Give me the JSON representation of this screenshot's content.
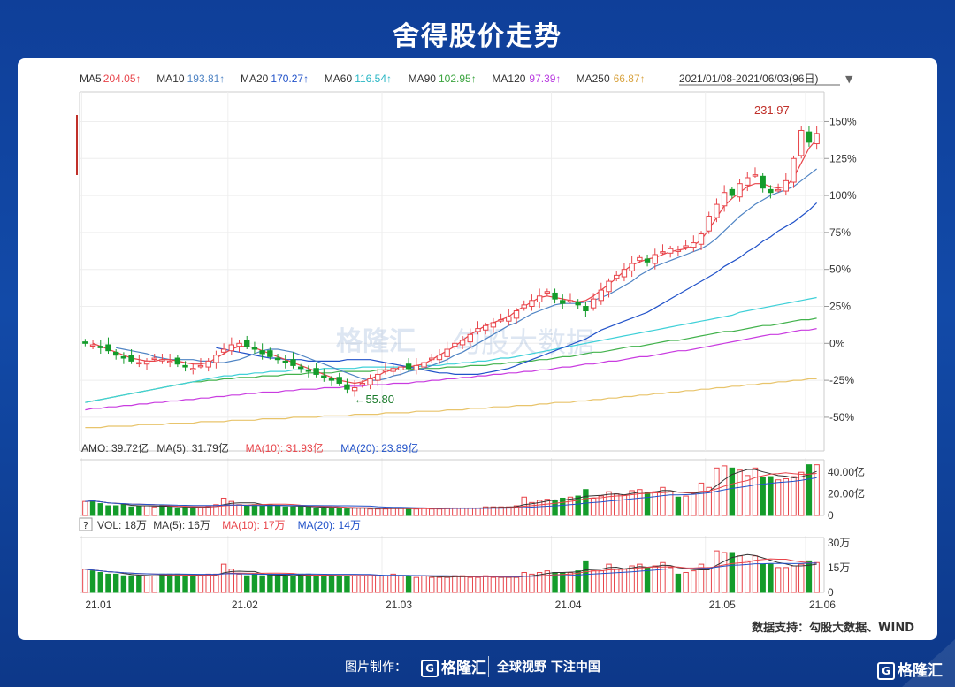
{
  "title": "舍得股价走势",
  "source_note": "数据支持：勾股大数据、WIND",
  "footer": {
    "credit": "图片制作：",
    "logo": "格隆汇",
    "slogan": "全球视野 下注中国"
  },
  "watermark": {
    "logo": "格隆汇",
    "text": "勾股大数据"
  },
  "colors": {
    "up": "#e8444a",
    "down": "#149c2b",
    "background": "#1247a8",
    "ma5": "#e8444a",
    "ma10": "#4f84c4",
    "ma20": "#2152c9",
    "ma60": "#3fd0d8",
    "ma90": "#42b24c",
    "ma120": "#c93ce0",
    "ma250": "#e8c46b"
  },
  "chart_data": {
    "type": "candlestick",
    "legend": [
      {
        "label": "MA5",
        "value": "204.05↑",
        "color": "#e8444a"
      },
      {
        "label": "MA10",
        "value": "193.81↑",
        "color": "#4f84c4"
      },
      {
        "label": "MA20",
        "value": "170.27↑",
        "color": "#2152c9"
      },
      {
        "label": "MA60",
        "value": "116.54↑",
        "color": "#29b6c4"
      },
      {
        "label": "MA90",
        "value": "102.95↑",
        "color": "#3ba43f"
      },
      {
        "label": "MA120",
        "value": "97.39↑",
        "color": "#b93ce0"
      },
      {
        "label": "MA250",
        "value": "66.87↑",
        "color": "#d9a441"
      }
    ],
    "date_range": "2021/01/08-2021/06/03(96日)",
    "annotations": {
      "high": "231.97",
      "low": "55.80"
    },
    "y_axis": {
      "ticks": [
        "150%",
        "125%",
        "100%",
        "75%",
        "50%",
        "25%",
        "0%",
        "-25%",
        "-50%"
      ],
      "range_pct": [
        -62,
        170
      ]
    },
    "x_axis": {
      "ticks": [
        "21.01",
        "21.02",
        "21.03",
        "21.04",
        "21.05",
        "21.06"
      ]
    },
    "close_pct": [
      0,
      -1,
      -3,
      -5,
      -8,
      -10,
      -12,
      -13,
      -12,
      -10,
      -11,
      -12,
      -14,
      -16,
      -17,
      -15,
      -12,
      -8,
      -4,
      -1,
      0,
      -2,
      -4,
      -7,
      -9,
      -11,
      -13,
      -15,
      -17,
      -19,
      -21,
      -23,
      -25,
      -27,
      -31,
      -30,
      -27,
      -24,
      -21,
      -18,
      -17,
      -16,
      -17,
      -15,
      -13,
      -10,
      -8,
      -4,
      0,
      2,
      6,
      10,
      12,
      14,
      16,
      18,
      22,
      26,
      29,
      32,
      35,
      30,
      27,
      29,
      26,
      22,
      30,
      36,
      42,
      46,
      50,
      54,
      58,
      55,
      60,
      62,
      64,
      63,
      66,
      68,
      74,
      86,
      94,
      102,
      100,
      108,
      112,
      114,
      105,
      102,
      104,
      110,
      125,
      144,
      136,
      142
    ],
    "moving_averages_pct": {
      "ma5": [
        0,
        -2,
        -4,
        -6,
        -8,
        -10,
        -11,
        -12,
        -12,
        -11,
        -11,
        -12,
        -13,
        -14,
        -14,
        -13,
        -10,
        -7,
        -4,
        -2,
        -2,
        -3,
        -5,
        -7,
        -9,
        -11,
        -13,
        -15,
        -17,
        -19,
        -21,
        -23,
        -25,
        -26,
        -27,
        -26,
        -24,
        -22,
        -19,
        -18,
        -16,
        -16,
        -15,
        -14,
        -11,
        -8,
        -5,
        -2,
        2,
        6,
        9,
        12,
        14,
        16,
        18,
        22,
        25,
        28,
        31,
        32,
        31,
        30,
        29,
        28,
        29,
        32,
        36,
        40,
        44,
        49,
        53,
        55,
        57,
        58,
        60,
        62,
        63,
        64,
        66,
        70,
        77,
        85,
        93,
        98,
        102,
        106,
        108,
        108,
        106,
        105,
        106,
        112,
        122,
        132,
        138
      ],
      "ma10": [
        -3,
        -4,
        -5,
        -6,
        -7,
        -9,
        -10,
        -11,
        -11,
        -11,
        -11,
        -12,
        -12,
        -13,
        -13,
        -12,
        -11,
        -9,
        -7,
        -5,
        -4,
        -4,
        -5,
        -6,
        -8,
        -10,
        -12,
        -14,
        -16,
        -18,
        -20,
        -22,
        -24,
        -25,
        -25,
        -24,
        -22,
        -21,
        -19,
        -18,
        -17,
        -15,
        -13,
        -11,
        -8,
        -6,
        -3,
        0,
        3,
        6,
        9,
        12,
        14,
        17,
        20,
        22,
        24,
        26,
        27,
        27,
        27,
        28,
        29,
        31,
        33,
        36,
        39,
        42,
        46,
        49,
        52,
        54,
        56,
        58,
        60,
        62,
        64,
        67,
        71,
        76,
        81,
        86,
        90,
        94,
        97,
        100,
        102,
        104,
        106,
        110,
        114,
        118
      ],
      "ma20": [
        -3,
        -4,
        -5,
        -6,
        -7,
        -8,
        -9,
        -10,
        -10,
        -11,
        -11,
        -11,
        -12,
        -12,
        -12,
        -12,
        -12,
        -11,
        -11,
        -11,
        -11,
        -12,
        -13,
        -14,
        -15,
        -16,
        -17,
        -18,
        -19,
        -20,
        -20,
        -21,
        -21,
        -21,
        -21,
        -20,
        -19,
        -18,
        -17,
        -15,
        -13,
        -11,
        -9,
        -7,
        -5,
        -3,
        -1,
        1,
        3,
        6,
        9,
        11,
        13,
        15,
        17,
        19,
        21,
        24,
        27,
        30,
        33,
        36,
        39,
        42,
        45,
        48,
        52,
        55,
        58,
        62,
        65,
        69,
        72,
        76,
        79,
        82,
        86,
        90,
        95
      ],
      "ma60": [
        -40,
        -39,
        -38,
        -37,
        -36,
        -35,
        -34,
        -33,
        -32,
        -31,
        -30,
        -29,
        -28,
        -27,
        -26,
        -25,
        -24,
        -23,
        -22,
        -22,
        -21,
        -21,
        -20,
        -20,
        -19,
        -19,
        -19,
        -18,
        -18,
        -18,
        -18,
        -17,
        -17,
        -17,
        -17,
        -17,
        -16,
        -16,
        -16,
        -16,
        -16,
        -16,
        -16,
        -16,
        -15,
        -15,
        -15,
        -14,
        -14,
        -13,
        -13,
        -12,
        -12,
        -11,
        -10,
        -10,
        -9,
        -8,
        -7,
        -6,
        -5,
        -4,
        -3,
        -2,
        -1,
        0,
        1,
        2,
        3,
        4,
        5,
        6,
        7,
        8,
        9,
        10,
        11,
        12,
        13,
        14,
        15,
        16,
        17,
        18,
        19,
        21,
        22,
        23,
        24,
        25,
        26,
        27,
        28,
        29,
        30,
        31
      ],
      "ma90": [
        -40,
        -39,
        -38,
        -37,
        -36,
        -35,
        -34,
        -33,
        -32,
        -31,
        -30,
        -29,
        -28,
        -27,
        -26,
        -26,
        -25,
        -25,
        -24,
        -24,
        -23,
        -23,
        -23,
        -22,
        -22,
        -22,
        -21,
        -21,
        -21,
        -20,
        -20,
        -20,
        -20,
        -19,
        -19,
        -19,
        -19,
        -19,
        -18,
        -18,
        -18,
        -18,
        -18,
        -17,
        -17,
        -17,
        -17,
        -16,
        -16,
        -16,
        -15,
        -15,
        -15,
        -14,
        -14,
        -13,
        -13,
        -12,
        -12,
        -11,
        -11,
        -10,
        -9,
        -9,
        -8,
        -7,
        -6,
        -6,
        -5,
        -4,
        -3,
        -2,
        -2,
        -1,
        0,
        1,
        2,
        2,
        3,
        4,
        5,
        6,
        7,
        8,
        8,
        9,
        10,
        11,
        12,
        12,
        13,
        14,
        15,
        16,
        16,
        17
      ],
      "ma120": [
        -45,
        -44,
        -44,
        -43,
        -43,
        -42,
        -42,
        -41,
        -41,
        -40,
        -40,
        -39,
        -39,
        -38,
        -38,
        -37,
        -37,
        -36,
        -36,
        -35,
        -35,
        -34,
        -34,
        -33,
        -33,
        -33,
        -32,
        -32,
        -31,
        -31,
        -31,
        -30,
        -30,
        -30,
        -29,
        -29,
        -29,
        -28,
        -28,
        -28,
        -27,
        -27,
        -27,
        -26,
        -26,
        -25,
        -25,
        -24,
        -24,
        -23,
        -23,
        -22,
        -22,
        -21,
        -21,
        -20,
        -20,
        -19,
        -19,
        -18,
        -18,
        -17,
        -16,
        -16,
        -15,
        -14,
        -14,
        -13,
        -12,
        -12,
        -11,
        -10,
        -9,
        -9,
        -8,
        -7,
        -6,
        -5,
        -5,
        -4,
        -3,
        -2,
        -1,
        0,
        1,
        2,
        3,
        4,
        5,
        6,
        6,
        7,
        8,
        9,
        9,
        10
      ],
      "ma250": [
        -57,
        -57,
        -57,
        -56,
        -56,
        -56,
        -56,
        -55,
        -55,
        -55,
        -55,
        -54,
        -54,
        -54,
        -54,
        -53,
        -53,
        -53,
        -53,
        -52,
        -52,
        -52,
        -52,
        -51,
        -51,
        -51,
        -51,
        -50,
        -50,
        -50,
        -50,
        -49,
        -49,
        -49,
        -49,
        -48,
        -48,
        -48,
        -48,
        -47,
        -47,
        -47,
        -47,
        -46,
        -46,
        -46,
        -46,
        -45,
        -45,
        -45,
        -44,
        -44,
        -44,
        -43,
        -43,
        -43,
        -42,
        -42,
        -42,
        -41,
        -41,
        -40,
        -40,
        -40,
        -39,
        -39,
        -38,
        -38,
        -37,
        -37,
        -36,
        -36,
        -35,
        -35,
        -34,
        -34,
        -33,
        -33,
        -32,
        -32,
        -31,
        -31,
        -30,
        -30,
        -29,
        -29,
        -28,
        -28,
        -27,
        -27,
        -26,
        -26,
        -25,
        -25,
        -24,
        -24
      ]
    },
    "amount_panel": {
      "legend": [
        {
          "label": "AMO:",
          "value": "39.72亿",
          "color": "#333333"
        },
        {
          "label": "MA(5):",
          "value": "31.79亿",
          "color": "#333333"
        },
        {
          "label": "MA(10):",
          "value": "31.93亿",
          "color": "#e8444a"
        },
        {
          "label": "MA(20):",
          "value": "23.89亿",
          "color": "#2152c9"
        }
      ],
      "y_ticks": [
        "40.00亿",
        "20.00亿",
        "0"
      ],
      "y_max": 50
    },
    "volume_panel": {
      "help": "?",
      "legend": [
        {
          "label": "VOL:",
          "value": "18万",
          "color": "#333333"
        },
        {
          "label": "MA(5):",
          "value": "16万",
          "color": "#333333"
        },
        {
          "label": "MA(10):",
          "value": "17万",
          "color": "#e8444a"
        },
        {
          "label": "MA(20):",
          "value": "14万",
          "color": "#2152c9"
        }
      ],
      "y_ticks": [
        "30万",
        "15万",
        "0"
      ],
      "y_max": 32
    },
    "amount_yi": [
      13,
      14,
      11,
      9,
      9,
      10,
      8,
      9,
      9,
      8,
      9,
      8,
      7,
      8,
      7,
      8,
      9,
      10,
      16,
      13,
      10,
      9,
      10,
      9,
      10,
      9,
      8,
      8,
      9,
      8,
      7,
      7,
      7,
      7,
      6,
      7,
      7,
      6,
      6,
      6,
      7,
      7,
      6,
      6,
      7,
      6,
      6,
      7,
      7,
      7,
      7,
      7,
      8,
      8,
      8,
      8,
      9,
      17,
      12,
      14,
      15,
      14,
      16,
      17,
      18,
      24,
      16,
      18,
      22,
      20,
      19,
      23,
      24,
      21,
      22,
      26,
      22,
      17,
      18,
      20,
      30,
      26,
      44,
      46,
      44,
      42,
      37,
      44,
      35,
      36,
      33,
      34,
      36,
      40,
      47,
      47
    ],
    "volume_wan": [
      14,
      13,
      12,
      11,
      11,
      10,
      10,
      10,
      10,
      10,
      11,
      11,
      11,
      10,
      10,
      10,
      11,
      11,
      17,
      14,
      11,
      10,
      11,
      10,
      11,
      10,
      10,
      10,
      11,
      11,
      10,
      10,
      10,
      10,
      10,
      10,
      10,
      10,
      10,
      10,
      11,
      10,
      10,
      9,
      10,
      9,
      9,
      9,
      10,
      10,
      9,
      9,
      10,
      9,
      9,
      9,
      9,
      12,
      11,
      12,
      13,
      12,
      12,
      12,
      13,
      19,
      13,
      13,
      17,
      14,
      14,
      16,
      17,
      15,
      16,
      18,
      15,
      11,
      12,
      13,
      17,
      15,
      25,
      24,
      24,
      22,
      19,
      22,
      17,
      17,
      15,
      15,
      16,
      17,
      19,
      18
    ]
  }
}
